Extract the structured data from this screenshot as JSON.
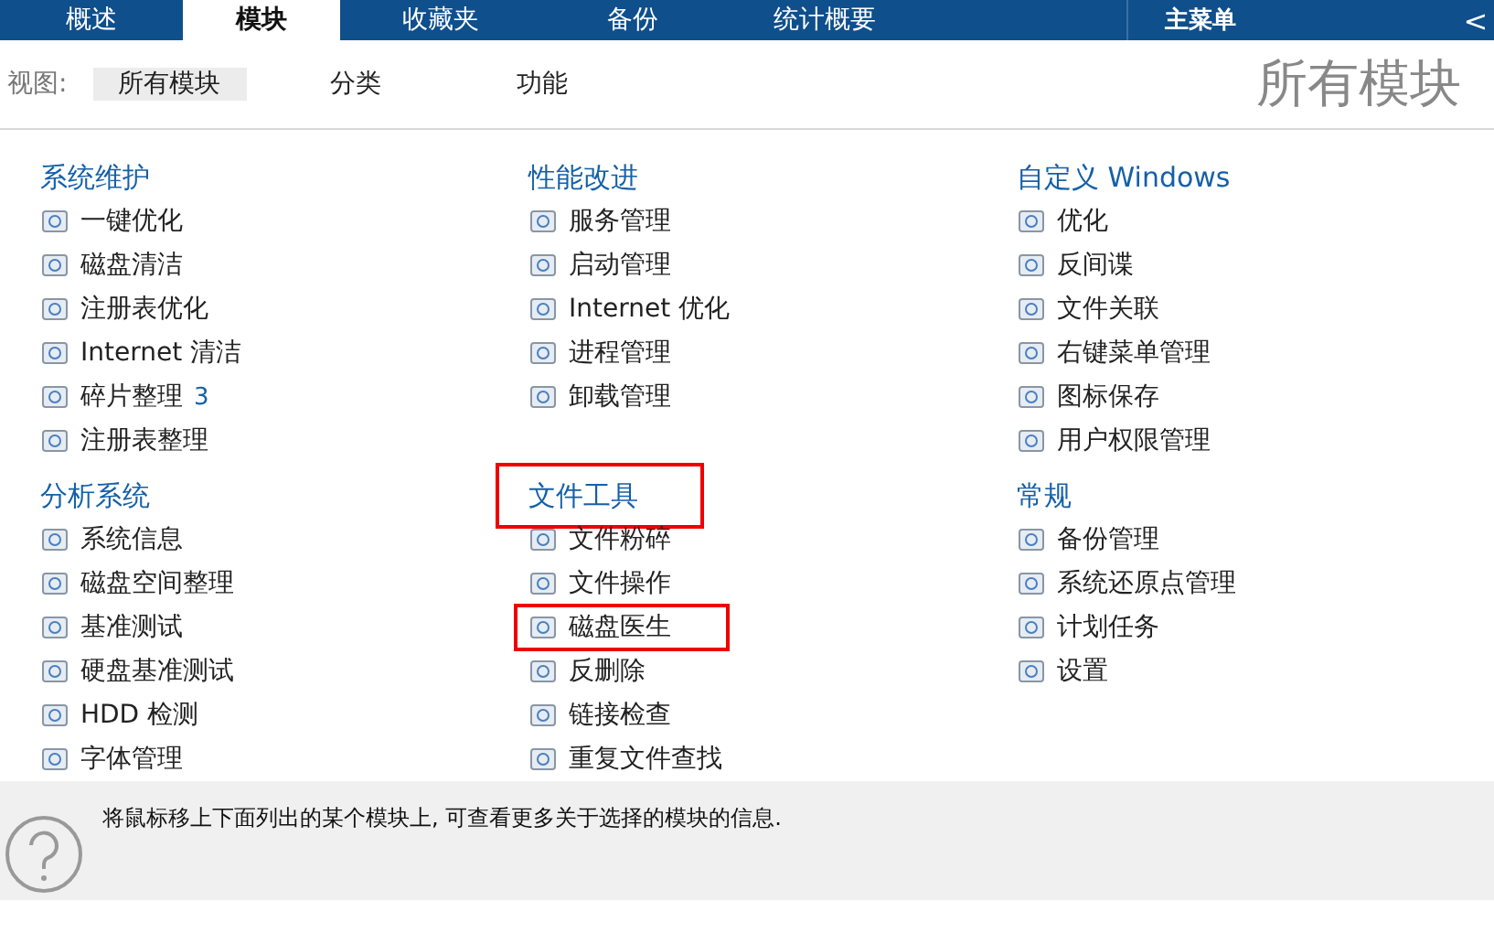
{
  "tabs": [
    {
      "label": "概述",
      "selected": false
    },
    {
      "label": "模块",
      "selected": true
    },
    {
      "label": "收藏夹",
      "selected": false
    },
    {
      "label": "备份",
      "selected": false
    },
    {
      "label": "统计概要",
      "selected": false
    }
  ],
  "main_menu": {
    "label": "主菜单",
    "arrow": "<"
  },
  "view": {
    "label": "视图:",
    "options": [
      {
        "label": "所有模块",
        "selected": true
      },
      {
        "label": "分类",
        "selected": false
      },
      {
        "label": "功能",
        "selected": false
      }
    ],
    "title": "所有模块"
  },
  "groups": [
    {
      "title": "系统维护",
      "highlighted": false,
      "items": [
        {
          "label": "一键优化",
          "highlighted": false
        },
        {
          "label": "磁盘清洁",
          "highlighted": false
        },
        {
          "label": "注册表优化",
          "highlighted": false
        },
        {
          "label": "Internet 清洁",
          "highlighted": false
        },
        {
          "label": "碎片整理",
          "count": "3",
          "highlighted": false
        },
        {
          "label": "注册表整理",
          "highlighted": false
        }
      ]
    },
    {
      "title": "性能改进",
      "highlighted": false,
      "items": [
        {
          "label": "服务管理",
          "highlighted": false
        },
        {
          "label": "启动管理",
          "highlighted": false
        },
        {
          "label": "Internet 优化",
          "highlighted": false
        },
        {
          "label": "进程管理",
          "highlighted": false
        },
        {
          "label": "卸载管理",
          "highlighted": false
        }
      ]
    },
    {
      "title": "自定义 Windows",
      "highlighted": false,
      "items": [
        {
          "label": "优化",
          "highlighted": false
        },
        {
          "label": "反间谍",
          "highlighted": false
        },
        {
          "label": "文件关联",
          "highlighted": false
        },
        {
          "label": "右键菜单管理",
          "highlighted": false
        },
        {
          "label": "图标保存",
          "highlighted": false
        },
        {
          "label": "用户权限管理",
          "highlighted": false
        }
      ]
    },
    {
      "title": "分析系统",
      "highlighted": false,
      "items": [
        {
          "label": "系统信息",
          "highlighted": false
        },
        {
          "label": "磁盘空间整理",
          "highlighted": false
        },
        {
          "label": "基准测试",
          "highlighted": false
        },
        {
          "label": "硬盘基准测试",
          "highlighted": false
        },
        {
          "label": "HDD 检测",
          "highlighted": false
        },
        {
          "label": "字体管理",
          "highlighted": false
        }
      ]
    },
    {
      "title": "文件工具",
      "highlighted": true,
      "items": [
        {
          "label": "文件粉碎",
          "highlighted": false
        },
        {
          "label": "文件操作",
          "highlighted": false
        },
        {
          "label": "磁盘医生",
          "highlighted": true
        },
        {
          "label": "反删除",
          "highlighted": false
        },
        {
          "label": "链接检查",
          "highlighted": false
        },
        {
          "label": "重复文件查找",
          "highlighted": false
        }
      ]
    },
    {
      "title": "常规",
      "highlighted": false,
      "items": [
        {
          "label": "备份管理",
          "highlighted": false
        },
        {
          "label": "系统还原点管理",
          "highlighted": false
        },
        {
          "label": "计划任务",
          "highlighted": false
        },
        {
          "label": "设置",
          "highlighted": false
        }
      ]
    }
  ],
  "help": {
    "text": "将鼠标移上下面列出的某个模块上, 可查看更多关于选择的模块的信息."
  }
}
